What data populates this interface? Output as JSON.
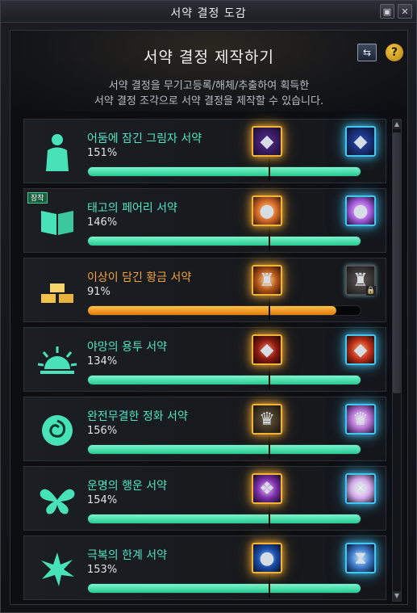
{
  "window": {
    "title": "서약 결정 도감"
  },
  "header": {
    "heading": "서약 결정 제작하기",
    "description_line1": "서약 결정을 무기고등록/해체/추출하여 획득한",
    "description_line2": "서약 결정 조각으로 서약 결정을 제작할 수 있습니다.",
    "swap_icon": "swap-arrows-icon",
    "help_label": "?"
  },
  "list": {
    "rows": [
      {
        "name": "어둠에 잠긴 그림자 서약",
        "percent": "151%",
        "progress": 1.0,
        "icon": "shadow-figure-icon",
        "gem_current": "dark-purple-gem",
        "gem_next": "dark-blue-gem"
      },
      {
        "name": "태고의 페어리 서약",
        "percent": "146%",
        "progress": 1.0,
        "icon": "book-icon",
        "badge": "장착",
        "gem_current": "rainbow-orb",
        "gem_next": "pink-orb"
      },
      {
        "name": "이상이 담긴 황금 서약",
        "percent": "91%",
        "progress": 0.91,
        "icon": "gold-bars-icon",
        "gem_current": "golden-relic",
        "gem_next": "locked-relic",
        "next_locked": true
      },
      {
        "name": "야망의 용투 서약",
        "percent": "134%",
        "progress": 1.0,
        "icon": "rising-sun-icon",
        "gem_current": "red-crystal",
        "gem_next": "red-crystal-upgraded"
      },
      {
        "name": "완전무결한 정화 서약",
        "percent": "156%",
        "progress": 1.0,
        "icon": "rose-icon",
        "gem_current": "dark-idol",
        "gem_next": "light-idol"
      },
      {
        "name": "운명의 행운 서약",
        "percent": "154%",
        "progress": 1.0,
        "icon": "butterfly-icon",
        "gem_current": "purple-crystal",
        "gem_next": "pale-crystal"
      },
      {
        "name": "극복의 한계 서약",
        "percent": "153%",
        "progress": 1.0,
        "icon": "starburst-icon",
        "gem_current": "blue-orb",
        "gem_next": "blue-hourglass"
      }
    ]
  },
  "colors": {
    "accent_green": "#51e5c1",
    "accent_gold": "#f4a339",
    "bar_green": "#27c98f",
    "bar_orange": "#e07a0b"
  }
}
